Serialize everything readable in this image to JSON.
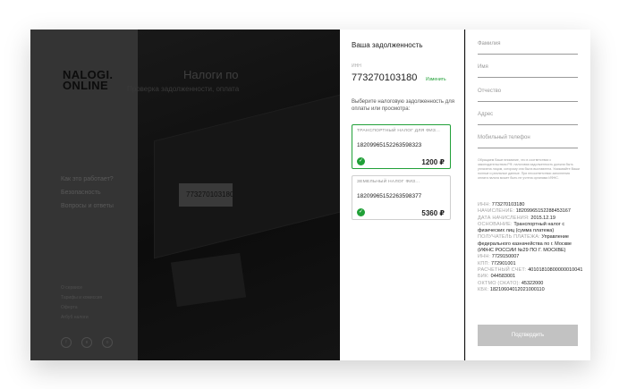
{
  "brand": {
    "line1": "NALOGI.",
    "line2": "ONLINE",
    "accent": "#21a038"
  },
  "nav": [
    "Как это работает?",
    "Безопасность",
    "Вопросы и ответы"
  ],
  "footer_links": [
    "О сервисе",
    "Тарифы и комиссия",
    "Оферта",
    "Агбуб налоги"
  ],
  "social": [
    {
      "icon": "f-icon",
      "glyph": "f"
    },
    {
      "icon": "vk-icon",
      "glyph": "в"
    },
    {
      "icon": "ok-icon",
      "glyph": "о"
    }
  ],
  "hero": {
    "title": "Налоги по",
    "subtitle": "Проверка задолженности, оплата",
    "inn_value": "773270103180"
  },
  "debt": {
    "title": "Ваша задолженность",
    "inn_label": "ИНН",
    "inn": "773270103180",
    "change_link": "Изменить",
    "choose_text": "Выберите налоговую задолженность для оплаты или просмотра:",
    "items": [
      {
        "title": "ТРАНСПОРТНЫЙ НАЛОГ ДЛЯ ФИЗ...",
        "id": "18209965152263598323",
        "amount": "1200 ₽",
        "selected": true
      },
      {
        "title": "ЗЕМЕЛЬНЫЙ НАЛОГ ФИЗ...",
        "id": "18209965152263598377",
        "amount": "5360 ₽",
        "selected": true
      }
    ]
  },
  "form": {
    "fields": [
      "Фамилия",
      "Имя",
      "Отчество",
      "Адрес",
      "Мобильный телефон"
    ],
    "note": "Обращаем Ваше внимание, что в соответствии с законодательством РФ, налоговая задолженность должна быть уплачена лицом, которому она была выставлена. Указывайте Ваши полные и реальные данные. При несоответствии заполнения оплата налога может быть не учтена органами ИФНС.",
    "requisites": [
      {
        "k": "ИНН:",
        "v": "773270103180"
      },
      {
        "k": "НАЧИСЛЕНИЕ:",
        "v": "18209965152288453167"
      },
      {
        "k": "ДАТА НАЧИСЛЕНИЯ:",
        "v": "2015.12.19"
      },
      {
        "k": "ОСНОВАНИЕ:",
        "v": "Транспортный налог с физических лиц (сумма платежа)"
      },
      {
        "k": "ПОЛУЧАТЕЛЬ ПЛАТЕЖА:",
        "v": "Управление федерального казначейства по г. Москве (ИФНС РОССИИ №29 ПО Г. МОСКВЕ)"
      },
      {
        "k": "ИНН:",
        "v": "7729150007"
      },
      {
        "k": "КПП:",
        "v": "772901001"
      },
      {
        "k": "РАСЧЕТНЫЙ СЧЕТ:",
        "v": "40101810800000010041"
      },
      {
        "k": "БИК:",
        "v": "044583001"
      },
      {
        "k": "ОКТМО (ОКАТО):",
        "v": "45322000"
      },
      {
        "k": "КБК:",
        "v": "18210604012021000110"
      }
    ],
    "submit": "Подтвердить"
  }
}
